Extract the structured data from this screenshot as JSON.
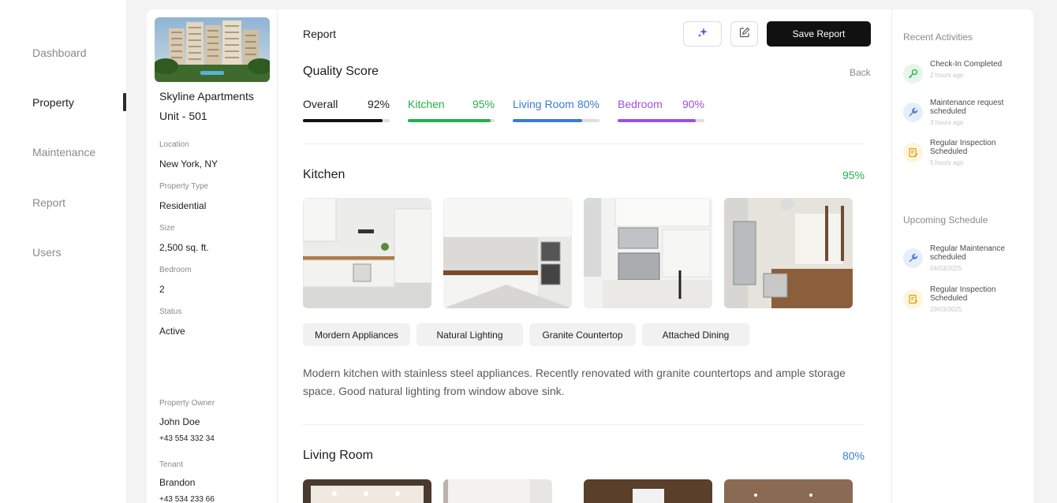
{
  "nav": {
    "items": [
      {
        "label": "Dashboard"
      },
      {
        "label": "Property"
      },
      {
        "label": "Maintenance"
      },
      {
        "label": "Report"
      },
      {
        "label": "Users"
      }
    ]
  },
  "property": {
    "name": "Skyline Apartments",
    "unit": "Unit - 501",
    "fields": [
      {
        "label": "Location",
        "value": "New York, NY"
      },
      {
        "label": "Property Type",
        "value": "Residential"
      },
      {
        "label": "Size",
        "value": "2,500 sq. ft."
      },
      {
        "label": "Bedroom",
        "value": "2"
      },
      {
        "label": "Status",
        "value": "Active"
      }
    ],
    "owner": {
      "label": "Property Owner",
      "name": "John Doe",
      "phone": "+43 554 332 34"
    },
    "tenant": {
      "label": "Tenant",
      "name": "Brandon",
      "phone": "+43 534 233 66"
    }
  },
  "report": {
    "title": "Report",
    "save_label": "Save Report",
    "quality_title": "Quality Score",
    "back_label": "Back",
    "scores": [
      {
        "label": "Overall",
        "pct": "92%",
        "value": 0.92,
        "color": "#111111"
      },
      {
        "label": "Kitchen",
        "pct": "95%",
        "value": 0.95,
        "color": "#22b14c"
      },
      {
        "label": "Living Room",
        "pct": "80%",
        "value": 0.8,
        "color": "#3a7bd5"
      },
      {
        "label": "Bedroom",
        "pct": "90%",
        "value": 0.9,
        "color": "#a050dc"
      }
    ],
    "kitchen": {
      "title": "Kitchen",
      "pct": "95%",
      "tags": [
        "Mordern Appliances",
        "Natural Lighting",
        "Granite Countertop",
        "Attached Dining"
      ],
      "description": "Modern kitchen with stainless steel appliances. Recently renovated with granite countertops and ample storage space. Good natural lighting from window above sink."
    },
    "living_room": {
      "title": "Living Room",
      "pct": "80%"
    }
  },
  "activities": {
    "recent_title": "Recent Activities",
    "recent": [
      {
        "text": "Check-In Completed",
        "time": "2 hours ago",
        "icon": "key-icon",
        "bg": "#e6f6ea",
        "fg": "#22b14c"
      },
      {
        "text": "Maintenance request scheduled",
        "time": "3 hours ago",
        "icon": "wrench-icon",
        "bg": "#e7eefb",
        "fg": "#4a7bd5"
      },
      {
        "text": "Regular Inspection Scheduled",
        "time": "5 hours ago",
        "icon": "note-icon",
        "bg": "#fdf5dc",
        "fg": "#d9a415"
      }
    ],
    "upcoming_title": "Upcoming Schedule",
    "upcoming": [
      {
        "text": "Regular Maintenance scheduled",
        "time": "04/03/2025",
        "icon": "wrench-icon",
        "bg": "#e7eefb",
        "fg": "#4a7bd5"
      },
      {
        "text": "Regular Inspection Scheduled",
        "time": "29/03/2025",
        "icon": "note-icon",
        "bg": "#fdf5dc",
        "fg": "#d9a415"
      }
    ]
  }
}
